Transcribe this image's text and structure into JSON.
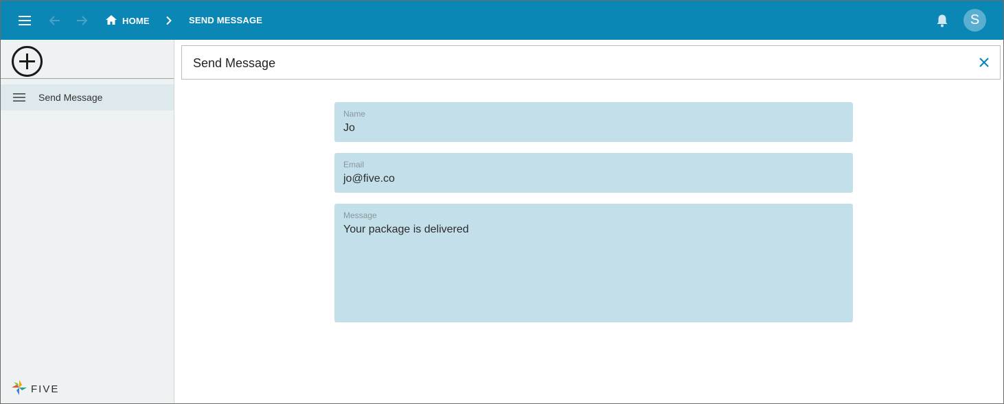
{
  "header": {
    "breadcrumb": {
      "home_label": "HOME",
      "current_label": "SEND MESSAGE"
    },
    "user_initial": "S",
    "icons": {
      "menu": "hamburger-menu-icon",
      "back": "arrow-left-icon",
      "forward": "arrow-right-icon",
      "home": "home-icon",
      "separator": "chevron-right-icon",
      "notifications": "bell-icon"
    },
    "colors": {
      "bar": "#0b87b5",
      "avatar": "#5aaed0"
    }
  },
  "sidebar": {
    "add_icon": "plus-circle-icon",
    "items": [
      {
        "label": "Send Message",
        "icon": "list-icon",
        "selected": true
      }
    ],
    "logo_text": "FIVE"
  },
  "form": {
    "title": "Send Message",
    "close_icon": "close-icon",
    "fields": [
      {
        "label": "Name",
        "value": "Jo"
      },
      {
        "label": "Email",
        "value": "jo@five.co"
      },
      {
        "label": "Message",
        "value": "Your package is delivered"
      }
    ],
    "colors": {
      "field_background": "#c3e0ea",
      "accent": "#0b87b5"
    }
  }
}
